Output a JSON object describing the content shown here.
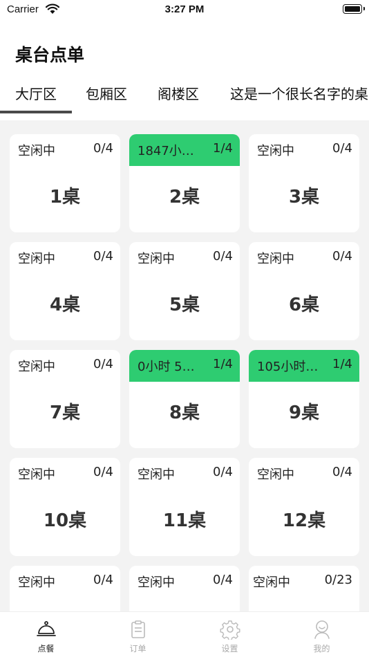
{
  "status_bar": {
    "carrier": "Carrier",
    "time": "3:27 PM"
  },
  "page_title": "桌台点单",
  "tabs": [
    {
      "label": "大厅区",
      "active": true
    },
    {
      "label": "包厢区",
      "active": false
    },
    {
      "label": "阁楼区",
      "active": false
    },
    {
      "label": "这是一个很长名字的桌",
      "active": false
    }
  ],
  "tables": [
    {
      "status": "空闲中",
      "count": "0/4",
      "name": "1桌",
      "busy": false
    },
    {
      "status": "1847小…",
      "count": "1/4",
      "name": "2桌",
      "busy": true
    },
    {
      "status": "空闲中",
      "count": "0/4",
      "name": "3桌",
      "busy": false
    },
    {
      "status": "空闲中",
      "count": "0/4",
      "name": "4桌",
      "busy": false
    },
    {
      "status": "空闲中",
      "count": "0/4",
      "name": "5桌",
      "busy": false
    },
    {
      "status": "空闲中",
      "count": "0/4",
      "name": "6桌",
      "busy": false
    },
    {
      "status": "空闲中",
      "count": "0/4",
      "name": "7桌",
      "busy": false
    },
    {
      "status": "0小时 5…",
      "count": "1/4",
      "name": "8桌",
      "busy": true
    },
    {
      "status": "105小时…",
      "count": "1/4",
      "name": "9桌",
      "busy": true
    },
    {
      "status": "空闲中",
      "count": "0/4",
      "name": "10桌",
      "busy": false
    },
    {
      "status": "空闲中",
      "count": "0/4",
      "name": "11桌",
      "busy": false
    },
    {
      "status": "空闲中",
      "count": "0/4",
      "name": "12桌",
      "busy": false
    },
    {
      "status": "空闲中",
      "count": "0/4",
      "name": "",
      "busy": false
    },
    {
      "status": "空闲中",
      "count": "0/4",
      "name": "",
      "busy": false
    },
    {
      "status": "空闲中",
      "count": "0/23",
      "name": "",
      "busy": false
    }
  ],
  "tab_bar": [
    {
      "label": "点餐",
      "icon": "cloche-icon",
      "active": true
    },
    {
      "label": "订单",
      "icon": "clipboard-icon",
      "active": false
    },
    {
      "label": "设置",
      "icon": "gear-icon",
      "active": false
    },
    {
      "label": "我的",
      "icon": "user-icon",
      "active": false
    }
  ],
  "colors": {
    "busy": "#2ecc71",
    "background": "#f3f3f3",
    "indicator": "#4a4a4a"
  }
}
